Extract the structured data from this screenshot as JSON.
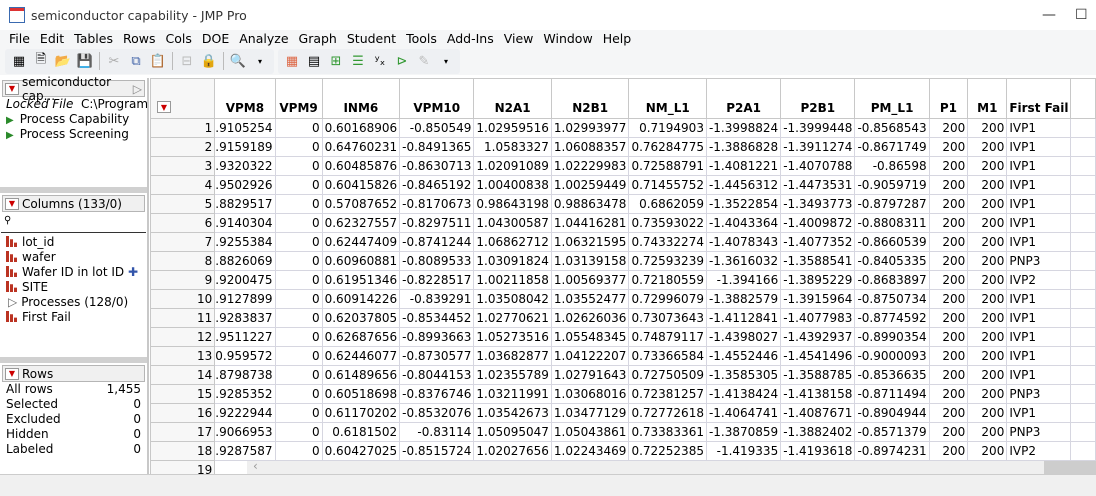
{
  "window": {
    "title": "semiconductor capability - JMP Pro"
  },
  "menu": [
    "File",
    "Edit",
    "Tables",
    "Rows",
    "Cols",
    "DOE",
    "Analyze",
    "Graph",
    "Student",
    "Tools",
    "Add-Ins",
    "View",
    "Window",
    "Help"
  ],
  "table_panel": {
    "name": "semiconductor cap...",
    "locked_label": "Locked File",
    "path": "C:\\Program Fil",
    "scripts": [
      "Process Capability",
      "Process Screening"
    ]
  },
  "columns_panel": {
    "header": "Columns (133/0)",
    "search_placeholder": "",
    "items": [
      "lot_id",
      "wafer",
      "Wafer ID in lot ID",
      "SITE",
      "Processes (128/0)",
      "First Fail"
    ]
  },
  "rows_panel": {
    "header": "Rows",
    "stats": [
      {
        "label": "All rows",
        "value": "1,455"
      },
      {
        "label": "Selected",
        "value": "0"
      },
      {
        "label": "Excluded",
        "value": "0"
      },
      {
        "label": "Hidden",
        "value": "0"
      },
      {
        "label": "Labeled",
        "value": "0"
      }
    ]
  },
  "grid": {
    "columns": [
      "VPM8",
      "VPM9",
      "INM6",
      "VPM10",
      "N2A1",
      "N2B1",
      "NM_L1",
      "P2A1",
      "P2B1",
      "PM_L1",
      "P1",
      "M1",
      "First Fail"
    ],
    "rows": [
      [
        ".9105254",
        "0",
        "0.60168906",
        "-0.850549",
        "1.02959516",
        "1.02993977",
        "0.7194903",
        "-1.3998824",
        "-1.3999448",
        "-0.8568543",
        "200",
        "200",
        "IVP1"
      ],
      [
        ".9159189",
        "0",
        "0.64760231",
        "-0.8491365",
        "1.0583327",
        "1.06088357",
        "0.76284775",
        "-1.3886828",
        "-1.3911274",
        "-0.8671749",
        "200",
        "200",
        "IVP1"
      ],
      [
        ".9320322",
        "0",
        "0.60485876",
        "-0.8630713",
        "1.02091089",
        "1.02229983",
        "0.72588791",
        "-1.4081221",
        "-1.4070788",
        "-0.86598",
        "200",
        "200",
        "IVP1"
      ],
      [
        ".9502926",
        "0",
        "0.60415826",
        "-0.8465192",
        "1.00400838",
        "1.00259449",
        "0.71455752",
        "-1.4456312",
        "-1.4473531",
        "-0.9059719",
        "200",
        "200",
        "IVP1"
      ],
      [
        ".8829517",
        "0",
        "0.57087652",
        "-0.8170673",
        "0.98643198",
        "0.98863478",
        "0.6862059",
        "-1.3522854",
        "-1.3493773",
        "-0.8797287",
        "200",
        "200",
        "IVP1"
      ],
      [
        ".9140304",
        "0",
        "0.62327557",
        "-0.8297511",
        "1.04300587",
        "1.04416281",
        "0.73593022",
        "-1.4043364",
        "-1.4009872",
        "-0.8808311",
        "200",
        "200",
        "IVP1"
      ],
      [
        ".9255384",
        "0",
        "0.62447409",
        "-0.8741244",
        "1.06862712",
        "1.06321595",
        "0.74332274",
        "-1.4078343",
        "-1.4077352",
        "-0.8660539",
        "200",
        "200",
        "IVP1"
      ],
      [
        ".8826069",
        "0",
        "0.60960881",
        "-0.8089533",
        "1.03091824",
        "1.03139158",
        "0.72593239",
        "-1.3616032",
        "-1.3588541",
        "-0.8405335",
        "200",
        "200",
        "PNP3"
      ],
      [
        ".9200475",
        "0",
        "0.61951346",
        "-0.8228517",
        "1.00211858",
        "1.00569377",
        "0.72180559",
        "-1.394166",
        "-1.3895229",
        "-0.8683897",
        "200",
        "200",
        "IVP2"
      ],
      [
        ".9127899",
        "0",
        "0.60914226",
        "-0.839291",
        "1.03508042",
        "1.03552477",
        "0.72996079",
        "-1.3882579",
        "-1.3915964",
        "-0.8750734",
        "200",
        "200",
        "IVP1"
      ],
      [
        ".9283837",
        "0",
        "0.62037805",
        "-0.8534452",
        "1.02770621",
        "1.02626036",
        "0.73073643",
        "-1.4112841",
        "-1.4077983",
        "-0.8774592",
        "200",
        "200",
        "IVP1"
      ],
      [
        ".9511227",
        "0",
        "0.62687656",
        "-0.8993663",
        "1.05273516",
        "1.05548345",
        "0.74879117",
        "-1.4398027",
        "-1.4392937",
        "-0.8990354",
        "200",
        "200",
        "IVP1"
      ],
      [
        "0.959572",
        "0",
        "0.62446077",
        "-0.8730577",
        "1.03682877",
        "1.04122207",
        "0.73366584",
        "-1.4552446",
        "-1.4541496",
        "-0.9000093",
        "200",
        "200",
        "IVP1"
      ],
      [
        ".8798738",
        "0",
        "0.61489656",
        "-0.8044153",
        "1.02355789",
        "1.02791643",
        "0.72750509",
        "-1.3585305",
        "-1.3588785",
        "-0.8536635",
        "200",
        "200",
        "IVP1"
      ],
      [
        ".9285352",
        "0",
        "0.60518698",
        "-0.8376746",
        "1.03211991",
        "1.03068016",
        "0.72381257",
        "-1.4138424",
        "-1.4138158",
        "-0.8711494",
        "200",
        "200",
        "PNP3"
      ],
      [
        ".9222944",
        "0",
        "0.61170202",
        "-0.8532076",
        "1.03542673",
        "1.03477129",
        "0.72772618",
        "-1.4064741",
        "-1.4087671",
        "-0.8904944",
        "200",
        "200",
        "IVP1"
      ],
      [
        ".9066953",
        "0",
        "0.6181502",
        "-0.83114",
        "1.05095047",
        "1.05043861",
        "0.73383361",
        "-1.3870859",
        "-1.3882402",
        "-0.8571379",
        "200",
        "200",
        "PNP3"
      ],
      [
        ".9287587",
        "0",
        "0.60427025",
        "-0.8515724",
        "1.02027656",
        "1.02243469",
        "0.72252385",
        "-1.419335",
        "-1.4193618",
        "-0.8974231",
        "200",
        "200",
        "IVP2"
      ]
    ],
    "next_row": "19"
  }
}
